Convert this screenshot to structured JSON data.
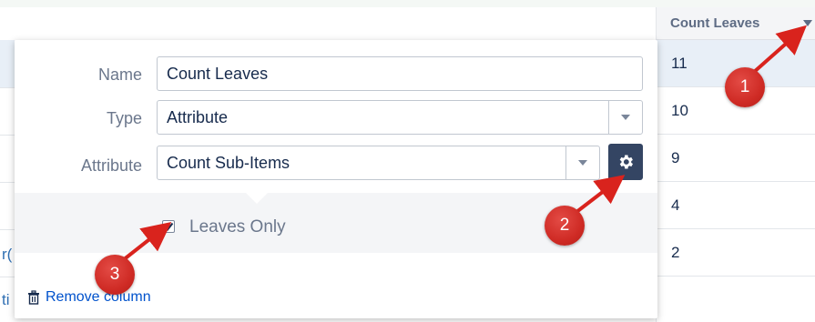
{
  "column_header": {
    "title": "Count Leaves"
  },
  "column_cells": [
    "11",
    "10",
    "9",
    "4",
    "2"
  ],
  "left_fragments": [
    "r(",
    "ti"
  ],
  "popup": {
    "name": {
      "label": "Name",
      "value": "Count Leaves"
    },
    "type": {
      "label": "Type",
      "value": "Attribute"
    },
    "attribute": {
      "label": "Attribute",
      "value": "Count Sub-Items"
    },
    "leaves_only": {
      "label": "Leaves Only",
      "checked": true
    },
    "remove_column": {
      "label": "Remove column"
    }
  },
  "annotations": [
    "1",
    "2",
    "3"
  ],
  "colors": {
    "accent": "#0052cc",
    "badge": "#cf2b25",
    "gear_button": "#344563"
  }
}
